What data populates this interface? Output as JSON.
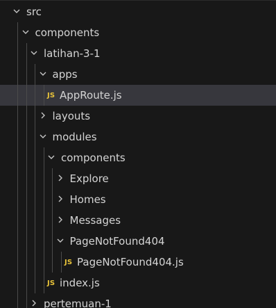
{
  "explorer": {
    "items": [
      {
        "label": "src",
        "type": "folder",
        "expanded": true,
        "depth": 0
      },
      {
        "label": "components",
        "type": "folder",
        "expanded": true,
        "depth": 1
      },
      {
        "label": "latihan-3-1",
        "type": "folder",
        "expanded": true,
        "depth": 2
      },
      {
        "label": "apps",
        "type": "folder",
        "expanded": true,
        "depth": 3
      },
      {
        "label": "AppRoute.js",
        "type": "file",
        "icon": "JS",
        "depth": 4,
        "selected": true
      },
      {
        "label": "layouts",
        "type": "folder",
        "expanded": false,
        "depth": 3
      },
      {
        "label": "modules",
        "type": "folder",
        "expanded": true,
        "depth": 3
      },
      {
        "label": "components",
        "type": "folder",
        "expanded": true,
        "depth": 4
      },
      {
        "label": "Explore",
        "type": "folder",
        "expanded": false,
        "depth": 5
      },
      {
        "label": "Homes",
        "type": "folder",
        "expanded": false,
        "depth": 5
      },
      {
        "label": "Messages",
        "type": "folder",
        "expanded": false,
        "depth": 5
      },
      {
        "label": "PageNotFound404",
        "type": "folder",
        "expanded": true,
        "depth": 5
      },
      {
        "label": "PageNotFound404.js",
        "type": "file",
        "icon": "JS",
        "depth": 6
      },
      {
        "label": "index.js",
        "type": "file",
        "icon": "JS",
        "depth": 4
      },
      {
        "label": "pertemuan-1",
        "type": "folder",
        "expanded": false,
        "depth": 2
      }
    ],
    "colors": {
      "background": "#181818",
      "selected": "#37373d",
      "text": "#d4d4d4",
      "js_icon": "#e8c33a",
      "guide": "#4b4b4b"
    }
  }
}
